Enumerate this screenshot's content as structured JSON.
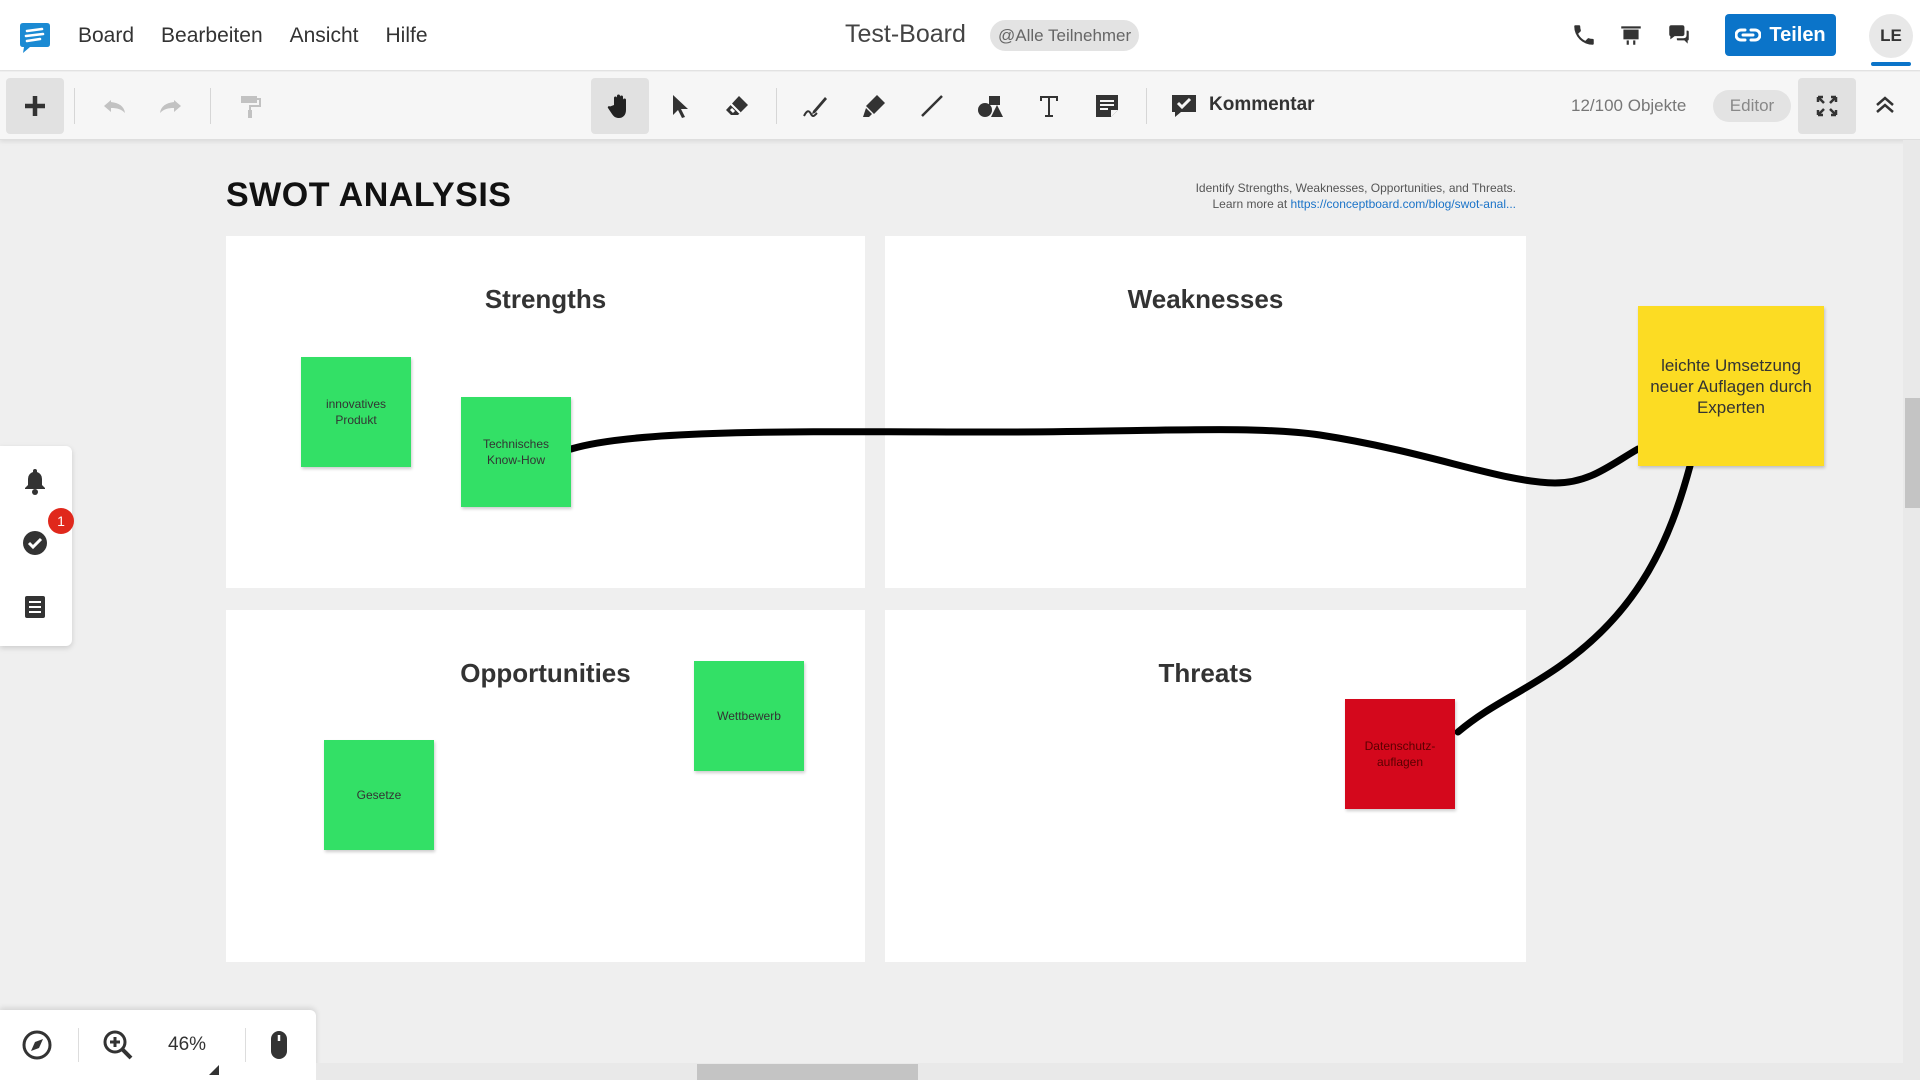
{
  "menu": {
    "items": [
      "Board",
      "Bearbeiten",
      "Ansicht",
      "Hilfe"
    ]
  },
  "header": {
    "board_title": "Test-Board",
    "participants": "@Alle Teilnehmer",
    "share_label": "Teilen",
    "avatar_initials": "LE"
  },
  "toolbar": {
    "comment_label": "Kommentar",
    "object_count": "12/100 Objekte",
    "role": "Editor"
  },
  "board": {
    "heading": "SWOT ANALYSIS",
    "desc_line1": "Identify Strengths, Weaknesses, Opportunities, and Threats.",
    "desc_prefix": "Learn more at ",
    "desc_link": "https://conceptboard.com/blog/swot-anal...",
    "quadrants": {
      "strengths": "Strengths",
      "weaknesses": "Weaknesses",
      "opportunities": "Opportunities",
      "threats": "Threats"
    },
    "stickies": {
      "innovatives": "innovatives Produkt",
      "technisches": "Technisches Know-How",
      "wettbewerb": "Wettbewerb",
      "gesetze": "Gesetze",
      "datenschutz": "Datenschutz-auflagen",
      "leichte": "leichte Umsetzung neuer Auflagen durch Experten"
    }
  },
  "side_panel": {
    "notification_count": "1"
  },
  "zoom": {
    "level": "46%"
  },
  "colors": {
    "accent": "#0b74c9",
    "sticky_green": "#33e066",
    "sticky_red": "#d4081c",
    "sticky_yellow": "#fcdc23",
    "badge_red": "#e0281c"
  }
}
